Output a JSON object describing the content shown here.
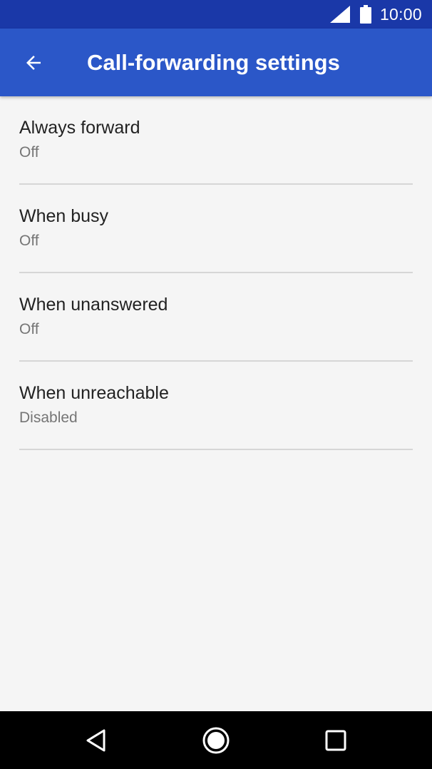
{
  "status_bar": {
    "time": "10:00",
    "icons": [
      "signal-icon",
      "battery-icon"
    ]
  },
  "app_bar": {
    "title": "Call-forwarding settings",
    "back_icon": "arrow-back-icon"
  },
  "settings": [
    {
      "title": "Always forward",
      "summary": "Off"
    },
    {
      "title": "When busy",
      "summary": "Off"
    },
    {
      "title": "When unanswered",
      "summary": "Off"
    },
    {
      "title": "When unreachable",
      "summary": "Disabled"
    }
  ],
  "nav_bar": {
    "icons": [
      "nav-back-icon",
      "nav-home-icon",
      "nav-recents-icon"
    ]
  },
  "colors": {
    "status_bar": "#1a38a8",
    "app_bar": "#2b57c8",
    "background": "#f5f5f5",
    "title_text": "#222222",
    "summary_text": "#757575",
    "divider": "#d6d6d6",
    "nav_bar": "#000000"
  }
}
